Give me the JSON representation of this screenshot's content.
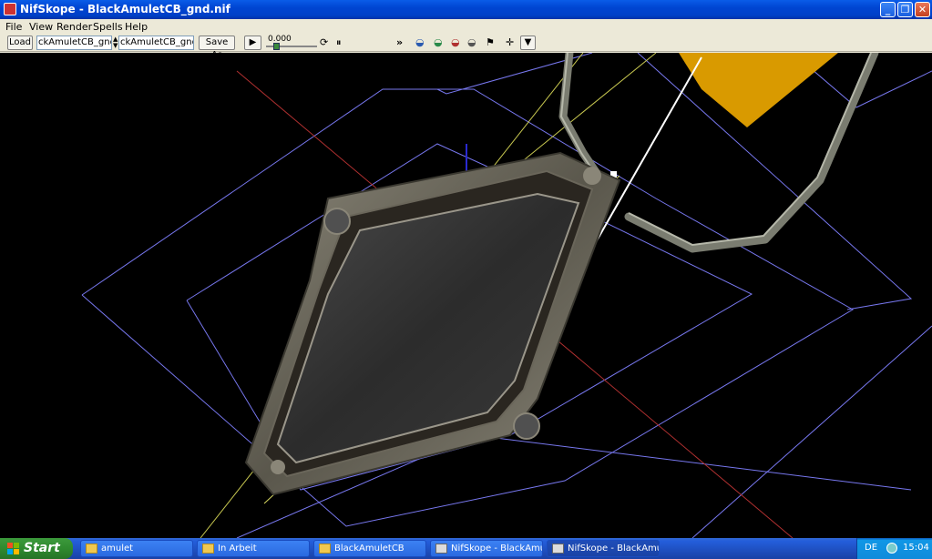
{
  "window": {
    "title": "NifSkope - BlackAmuletCB_gnd.nif"
  },
  "window_controls": {
    "minimize": "_",
    "maximize": "❐",
    "close": "✕"
  },
  "menu": [
    "File",
    "View",
    "Render",
    "Spells",
    "Help"
  ],
  "toolbar": {
    "load_label": "Load",
    "load_path": "ckAmuletCB_gnd.nif",
    "save_path": "ckAmuletCB_gnd.nif",
    "save_label": "Save As",
    "time_value": "0.000",
    "overflow": "»"
  },
  "taskbar": {
    "start_label": "Start",
    "tasks": [
      {
        "label": "amulet",
        "icon": "folder-icon"
      },
      {
        "label": "In Arbeit",
        "icon": "folder-icon"
      },
      {
        "label": "BlackAmuletCB",
        "icon": "folder-icon"
      },
      {
        "label": "NifSkope - BlackAmul...",
        "icon": "nifskope-icon"
      },
      {
        "label": "NifSkope - BlackAmul...",
        "icon": "nifskope-icon"
      }
    ],
    "tray": {
      "language": "DE",
      "clock": "15:04"
    }
  },
  "colors": {
    "viewport_bg": "#000000",
    "bounding_box": "#8888ff",
    "axis_red": "#c03030",
    "axis_blue": "#2020c0",
    "axis_yellow": "#c8c850",
    "highlight_plane": "#d99a00"
  }
}
